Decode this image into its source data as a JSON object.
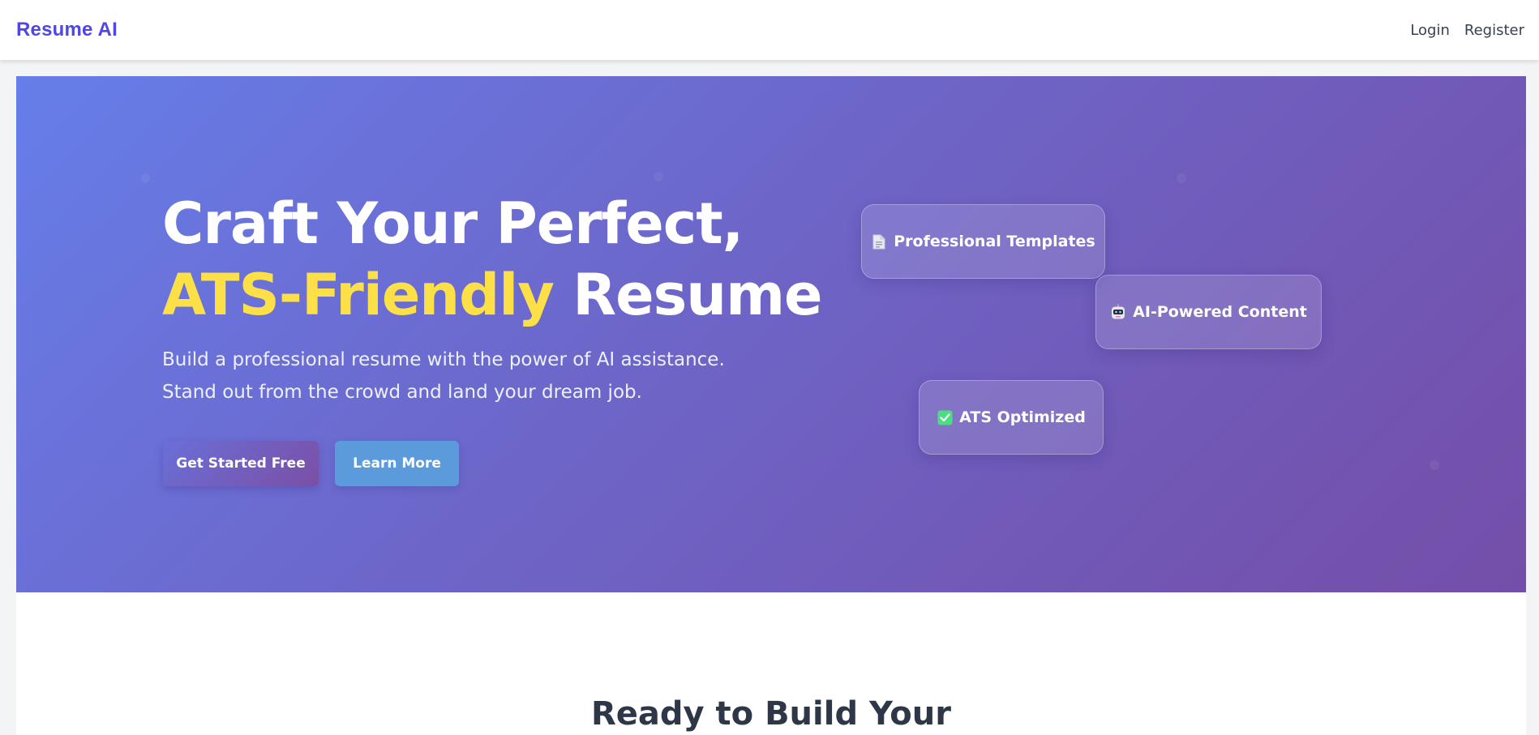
{
  "nav": {
    "brand": "Resume AI",
    "links": [
      {
        "label": "Login"
      },
      {
        "label": "Register"
      }
    ]
  },
  "hero": {
    "title_line1": "Craft Your Perfect,",
    "title_highlight": "ATS-Friendly",
    "title_rest": "Resume",
    "subtitle_line1": "Build a professional resume with the power of AI assistance.",
    "subtitle_line2": "Stand out from the crowd and land your dream job.",
    "primary_button": "Get Started Free",
    "secondary_button": "Learn More",
    "features": [
      {
        "icon": "document-icon",
        "label": "Professional Templates"
      },
      {
        "icon": "robot-icon",
        "label": "AI-Powered Content"
      },
      {
        "icon": "checkmark-icon",
        "label": "ATS Optimized"
      }
    ]
  },
  "cta": {
    "heading": "Ready to Build Your"
  },
  "colors": {
    "brand": "#4f46e5",
    "hero_gradient_start": "#667eea",
    "hero_gradient_end": "#764ba2",
    "highlight": "#fde047",
    "secondary_button": "#5b9bdc"
  }
}
